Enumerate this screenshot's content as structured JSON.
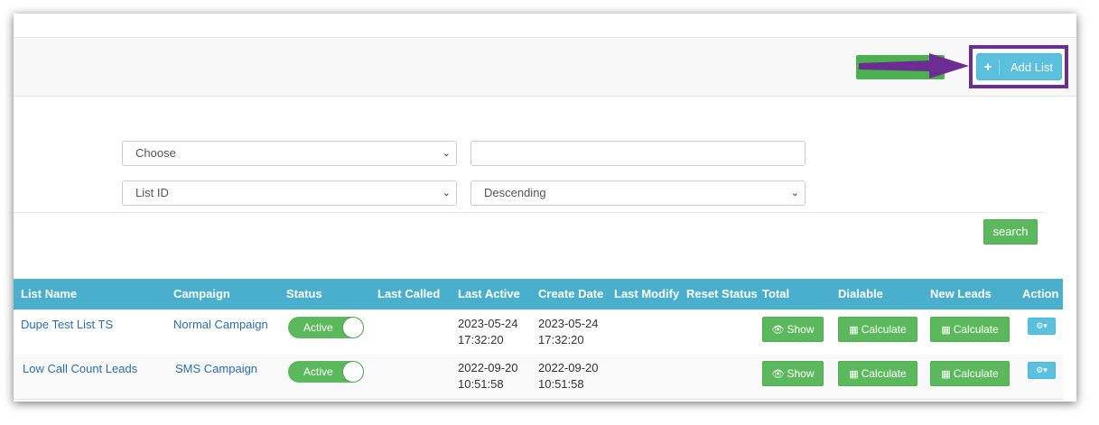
{
  "toolbar": {
    "add_list_label": "Add List",
    "add_icon": "plus-icon"
  },
  "filters": {
    "field_select": "Choose",
    "search_value": "",
    "sort_field": "List ID",
    "sort_order": "Descending",
    "search_label": "search"
  },
  "table": {
    "columns": [
      "List Name",
      "Campaign",
      "Status",
      "Last Called",
      "Last Active",
      "Create Date",
      "Last Modify",
      "Reset Status",
      "Total",
      "Dialable",
      "New Leads",
      "Action"
    ],
    "rows": [
      {
        "list_name": "Dupe Test List TS",
        "campaign": "Normal Campaign",
        "status": "Active",
        "last_called": "",
        "last_active_date": "2023-05-24",
        "last_active_time": "17:32:20",
        "create_date": "2023-05-24",
        "create_time": "17:32:20",
        "last_modify": "",
        "reset_status": "",
        "total_label": "Show",
        "dialable_label": "Calculate",
        "new_leads_label": "Calculate"
      },
      {
        "list_name": "Low Call Count Leads",
        "campaign": "SMS Campaign",
        "status": "Active",
        "last_called": "",
        "last_active_date": "2022-09-20",
        "last_active_time": "10:51:58",
        "create_date": "2022-09-20",
        "create_time": "10:51:58",
        "last_modify": "",
        "reset_status": "",
        "total_label": "Show",
        "dialable_label": "Calculate",
        "new_leads_label": "Calculate"
      }
    ]
  },
  "colors": {
    "header": "#49afcd",
    "green": "#5cb85c",
    "info": "#5bc0de",
    "highlight": "#6b2d91"
  }
}
